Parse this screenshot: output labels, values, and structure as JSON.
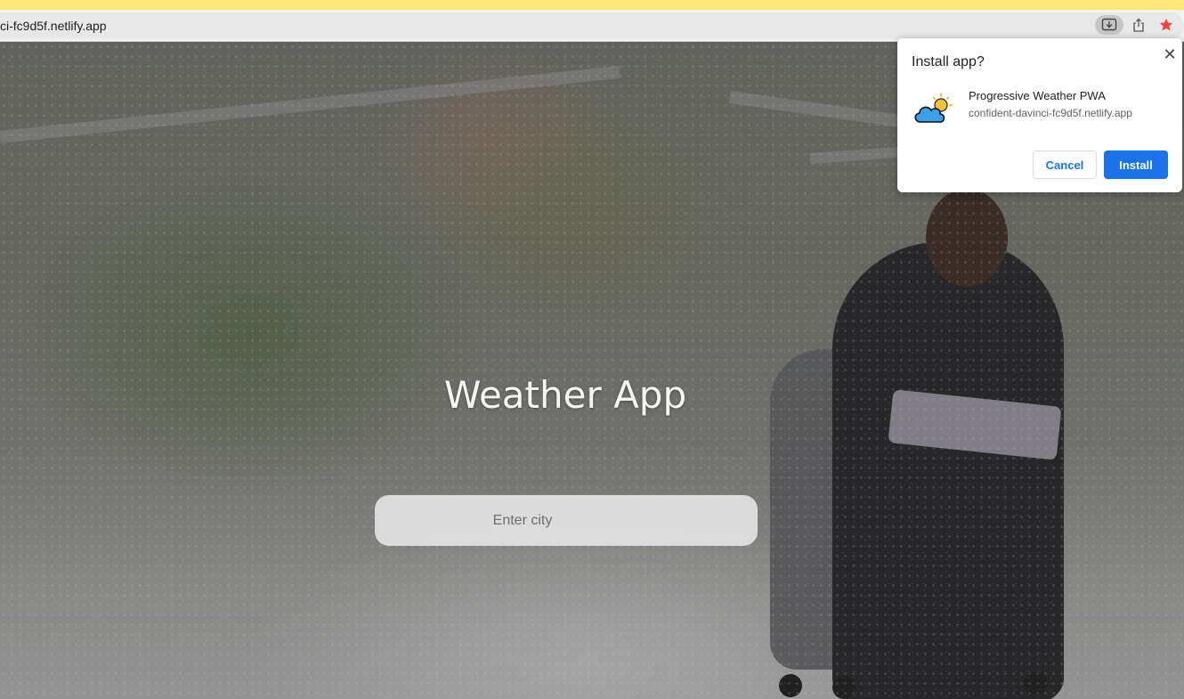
{
  "browser": {
    "url": "ci-fc9d5f.netlify.app",
    "icons": [
      "install-app-icon",
      "share-icon",
      "bookmark-star-icon"
    ]
  },
  "page": {
    "title": "Weather App",
    "search": {
      "placeholder": "Enter city",
      "value": ""
    }
  },
  "install_dialog": {
    "title": "Install app?",
    "close_icon": "close-icon",
    "app_icon": "partly-cloudy-icon",
    "app_name": "Progressive Weather PWA",
    "app_origin": "confident-davinci-fc9d5f.netlify.app",
    "cancel_label": "Cancel",
    "install_label": "Install"
  },
  "colors": {
    "accent": "#1a73e8",
    "star": "#e8453c",
    "top_strip": "#ffe57a"
  }
}
